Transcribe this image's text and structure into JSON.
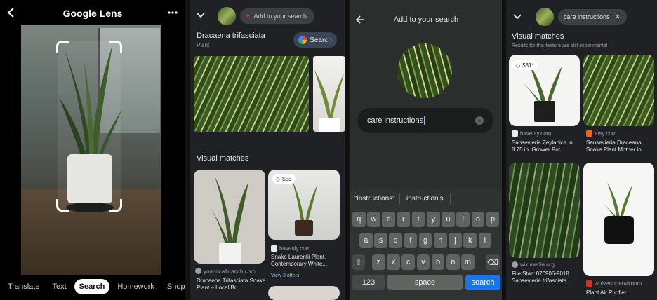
{
  "panel1": {
    "title": "Google Lens",
    "tabs": [
      {
        "label": "Translate",
        "active": false
      },
      {
        "label": "Text",
        "active": false
      },
      {
        "label": "Search",
        "active": true
      },
      {
        "label": "Homework",
        "active": false
      },
      {
        "label": "Shopp",
        "active": false
      }
    ]
  },
  "panel2": {
    "search_pill": "Add to your search",
    "entity_title": "Dracaena trifasciata",
    "entity_subtitle": "Plant",
    "search_button": "Search",
    "section_title": "Visual matches",
    "results": [
      {
        "price": "",
        "source": "yourlocalbranch.com",
        "title": "Dracaena Trifasciata Snake Plant – Local Br..."
      },
      {
        "price": "$53",
        "source": "havenly.com",
        "title": "Snake Laurentii Plant, Contemporary White...",
        "offers": "View 3 offers"
      }
    ]
  },
  "panel3": {
    "header_title": "Add to your search",
    "query": "care instructions",
    "suggestions": [
      "\"instructions\"",
      "instruction's"
    ],
    "keyboard": {
      "row1": [
        "q",
        "w",
        "e",
        "r",
        "t",
        "y",
        "u",
        "i",
        "o",
        "p"
      ],
      "row2": [
        "a",
        "s",
        "d",
        "f",
        "g",
        "h",
        "j",
        "k",
        "l"
      ],
      "row3": [
        "z",
        "x",
        "c",
        "v",
        "b",
        "n",
        "m"
      ],
      "numbers_key": "123",
      "space_key": "space",
      "search_key": "search"
    }
  },
  "panel4": {
    "chip_label": "care instructions",
    "section_title": "Visual matches",
    "section_note": "Results for this feature are still experimental",
    "results": [
      {
        "price": "$31*",
        "source": "havenly.com",
        "title": "Sansevieria Zeylanica in 8.75 in. Grower Pot"
      },
      {
        "price": "",
        "source": "etsy.com",
        "title": "Sansevieria Draceana Snake Plant Mother in..."
      },
      {
        "price": "",
        "source": "wikimedia.org",
        "title": "File:Starr 070906-9018 Sansevieria trifasciata..."
      },
      {
        "price": "",
        "source": "wolvertonenvironm...",
        "title": "Plant Air Purifier"
      }
    ]
  },
  "colors": {
    "accent": "#1a73e8",
    "background": "#202124"
  }
}
